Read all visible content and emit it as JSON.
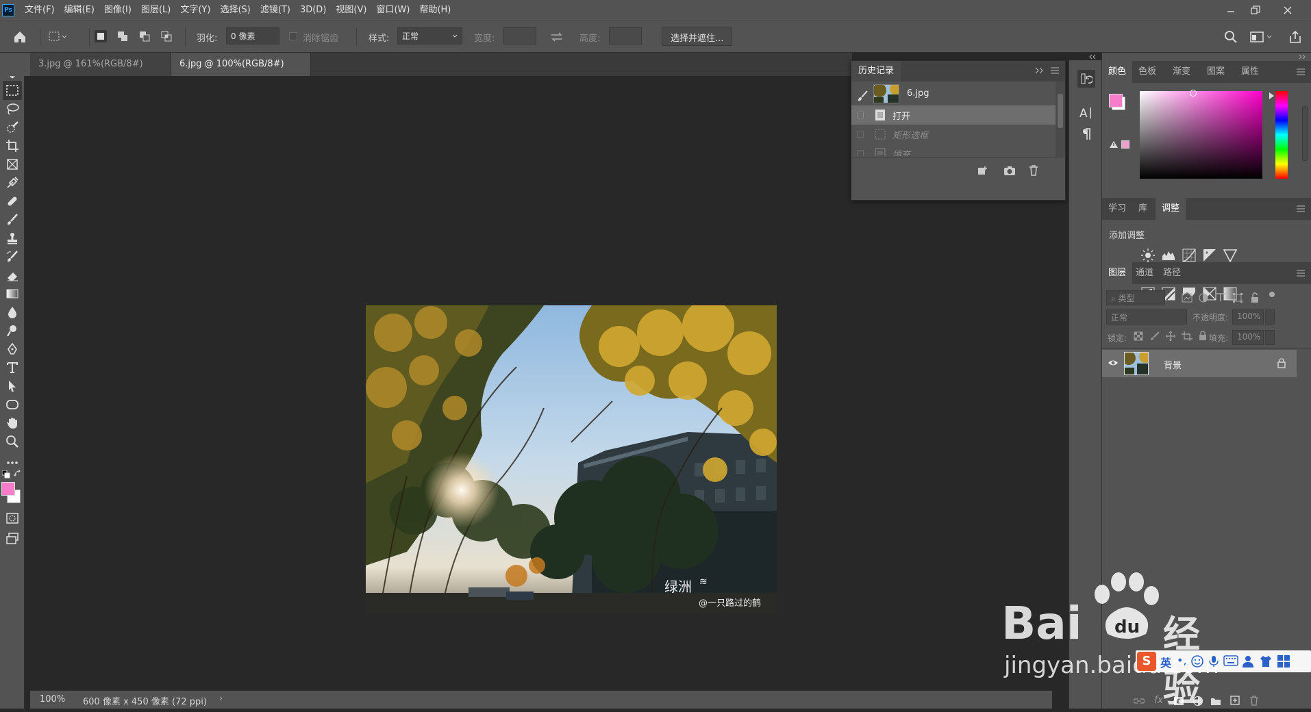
{
  "app": {
    "logo": "Ps"
  },
  "menu": [
    "文件(F)",
    "编辑(E)",
    "图像(I)",
    "图层(L)",
    "文字(Y)",
    "选择(S)",
    "滤镜(T)",
    "3D(D)",
    "视图(V)",
    "窗口(W)",
    "帮助(H)"
  ],
  "options": {
    "feather_label": "羽化:",
    "feather_value": "0 像素",
    "antialias_label": "消除锯齿",
    "style_label": "样式:",
    "style_value": "正常",
    "width_label": "宽度:",
    "height_label": "高度:",
    "select_mask_button": "选择并遮住..."
  },
  "tabs": [
    {
      "label": "3.jpg @ 161%(RGB/8#) *",
      "active": false
    },
    {
      "label": "6.jpg @ 100%(RGB/8#) *",
      "active": true
    }
  ],
  "photo": {
    "watermark_title": "绿洲",
    "watermark_credit": "@一只路过的鹤"
  },
  "status": {
    "zoom": "100%",
    "doc_info": "600 像素 x 450 像素 (72 ppi)",
    "arrow": "›"
  },
  "history": {
    "title": "历史记录",
    "snapshot": "6.jpg",
    "items": [
      "打开",
      "矩形选框",
      "填充"
    ]
  },
  "color_panel": {
    "tabs": [
      "颜色",
      "色板",
      "渐变",
      "图案",
      "属性"
    ],
    "foreground": "#f77dcb",
    "background": "#ffffff"
  },
  "adjust_panel": {
    "tabs": [
      "学习",
      "库",
      "调整"
    ],
    "heading": "添加调整"
  },
  "layers_panel": {
    "tabs": [
      "图层",
      "通道",
      "路径"
    ],
    "filter_placeholder": "类型",
    "blend_mode": "正常",
    "opacity_label": "不透明度:",
    "opacity_value": "100%",
    "lock_label": "锁定:",
    "fill_label": "填充:",
    "fill_value": "100%",
    "layer_name": "背景"
  },
  "overlay": {
    "baidu_brand": "Bai",
    "baidu_suffix": "经验",
    "baidu_url": "jingyan.baidu.com",
    "ime_label": "英"
  }
}
